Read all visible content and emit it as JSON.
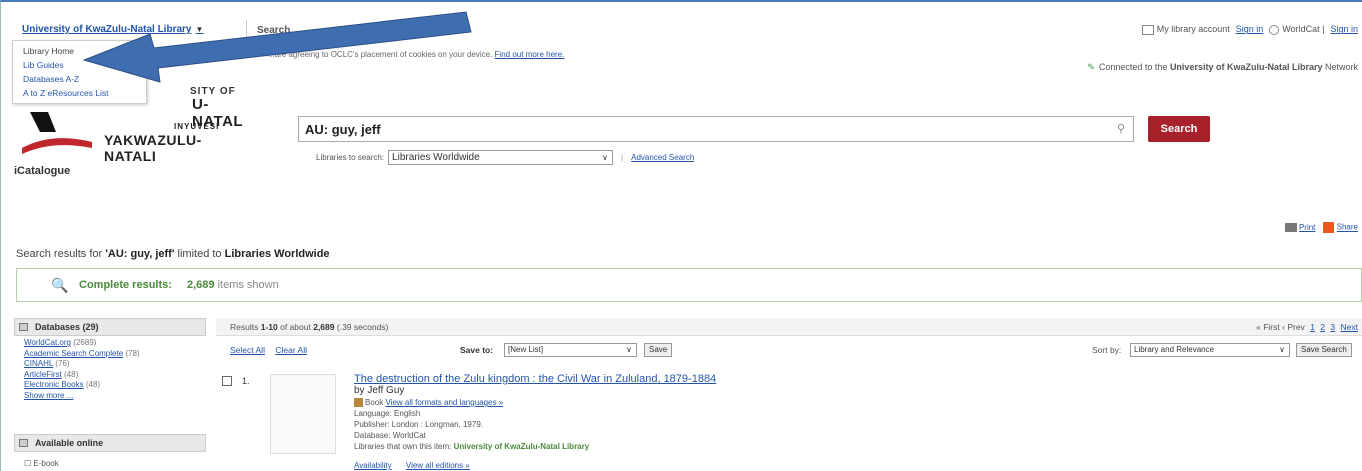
{
  "top": {
    "library_name": "University of KwaZulu-Natal Library",
    "caret": "▼",
    "search_tab": "Search",
    "my_account": "My library account",
    "sign_in": "Sign in",
    "worldcat": "WorldCat",
    "sign_in2": "Sign in"
  },
  "menu": {
    "items": [
      "Library Home",
      "Lib Guides",
      "Databases A-Z",
      "A to Z eResources List"
    ]
  },
  "cookie": {
    "text": "...are agreeing to OCLC's placement of cookies on your device.",
    "link": "Find out more here."
  },
  "connected": {
    "prefix": "Connected to the",
    "library": "University of KwaZulu-Natal Library",
    "suffix": "Network"
  },
  "logo": {
    "line1": "SITY OF",
    "line2": "U-NATAL",
    "line3": "INYUVESI",
    "line4": "YAKWAZULU-NATALI",
    "subtitle": "iCatalogue"
  },
  "search": {
    "query": "AU: guy, jeff",
    "button": "Search",
    "libs_label": "Libraries to search:",
    "libs_value": "Libraries Worldwide",
    "advanced": "Advanced Search"
  },
  "tools": {
    "print": "Print",
    "share": "Share"
  },
  "results_for": {
    "prefix": "Search results for",
    "query": "'AU: guy, jeff'",
    "middle": "limited to",
    "scope": "Libraries Worldwide"
  },
  "complete": {
    "label": "Complete results:",
    "count": "2,689",
    "suffix": "items shown"
  },
  "sidebar": {
    "databases_title": "Databases (29)",
    "databases": [
      {
        "name": "WorldCat.org",
        "count": "(2689)"
      },
      {
        "name": "Academic Search Complete",
        "count": "(78)"
      },
      {
        "name": "CINAHL",
        "count": "(76)"
      },
      {
        "name": "ArticleFirst",
        "count": "(48)"
      },
      {
        "name": "Electronic Books",
        "count": "(48)"
      }
    ],
    "show_more": "Show more ...",
    "online_title": "Available online",
    "online_option": "E-book"
  },
  "results": {
    "header_prefix": "Results",
    "range": "1-10",
    "header_mid": "of about",
    "total": "2,689",
    "time": "(.39 seconds)",
    "pager": {
      "first": "« First",
      "prev": "‹ Prev",
      "p1": "1",
      "p2": "2",
      "p3": "3",
      "next": "Next"
    },
    "select_all": "Select All",
    "clear_all": "Clear All",
    "save_to": "Save to:",
    "save_list": "[New List]",
    "save_btn": "Save",
    "sort_by": "Sort by:",
    "sort_value": "Library and Relevance",
    "save_search": "Save Search"
  },
  "item1": {
    "num": "1.",
    "title": "The destruction of the Zulu kingdom : the Civil War in Zululand, 1879-1884",
    "by": "by Jeff Guy",
    "format": "Book",
    "formats_link": "View all formats and languages »",
    "language": "Language: English",
    "publisher": "Publisher: London : Longman, 1979.",
    "database": "Database: WorldCat",
    "holding_prefix": "Libraries that own this item:",
    "holding": "University of KwaZulu-Natal Library",
    "availability": "Availability",
    "editions": "View all editions »"
  },
  "colors": {
    "accent_red": "#a7212b",
    "link_blue": "#2255aa",
    "green": "#4a8a3a",
    "arrow_blue": "#3e6eb0"
  }
}
